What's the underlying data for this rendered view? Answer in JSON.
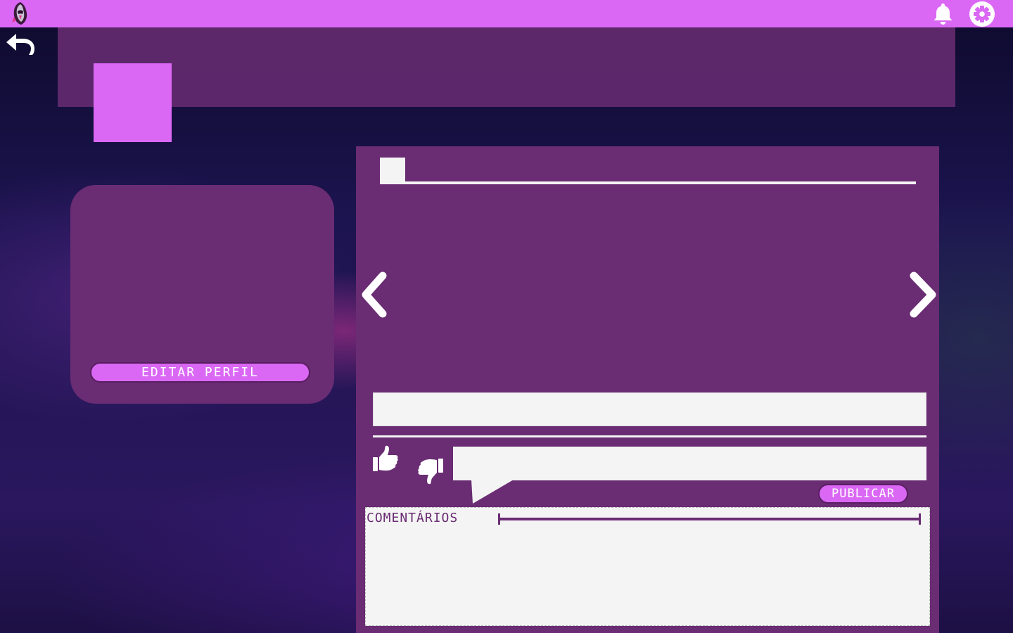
{
  "colors": {
    "topbar": "#da68f4",
    "panel": "#6a2c73",
    "accent": "#da68f4",
    "light": "#f4f4f4"
  },
  "topbar": {
    "logo_icon": "hooded-figure-logo-icon",
    "notification_icon": "bell-icon",
    "settings_icon": "gear-icon"
  },
  "navigation": {
    "back_icon": "undo-arrow-icon",
    "prev_icon": "chevron-left-icon",
    "next_icon": "chevron-right-icon"
  },
  "profile": {
    "edit_label": "EDITAR PERFIL"
  },
  "post": {
    "like_icon": "thumbs-up-icon",
    "dislike_icon": "thumbs-down-icon",
    "comment_value": "",
    "publish_label": "PUBLICAR"
  },
  "comments": {
    "title": "COMENTÁRIOS"
  }
}
